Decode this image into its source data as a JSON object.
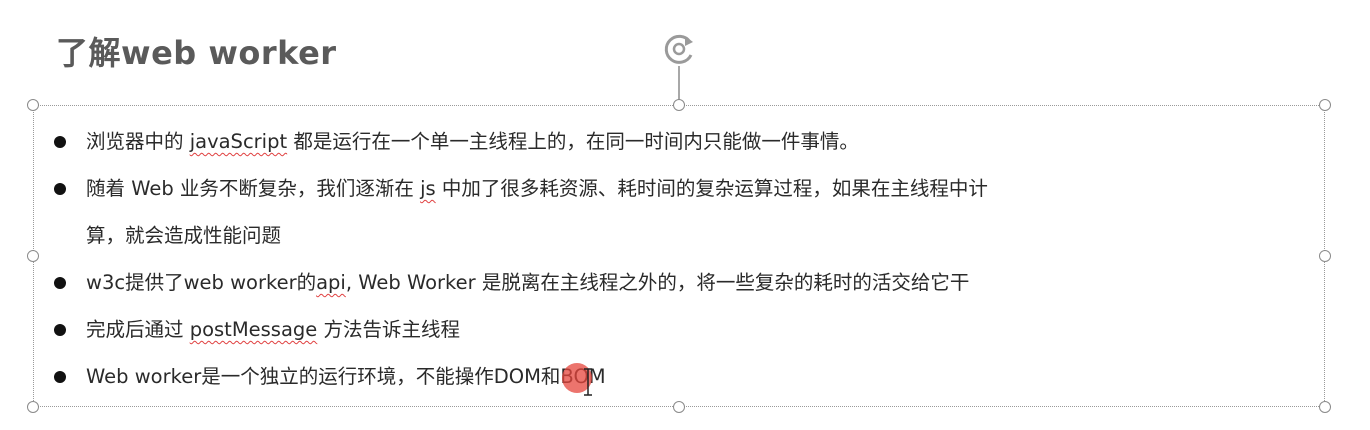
{
  "slide": {
    "title": "了解web worker"
  },
  "bullets": [
    {
      "parts": [
        {
          "text": "浏览器中的 "
        },
        {
          "text": "javaScript",
          "spellcheck": true
        },
        {
          "text": " 都是运行在一个单一主线程上的，在同一时间内只能做一件事情。"
        }
      ]
    },
    {
      "parts": [
        {
          "text": "随着 Web 业务不断复杂，我们逐渐在 "
        },
        {
          "text": "js",
          "spellcheck": true
        },
        {
          "text": " 中加了很多耗资源、耗时间的复杂运算过程，如果在主线程中计"
        }
      ],
      "continuation": "算，就会造成性能问题"
    },
    {
      "parts": [
        {
          "text": "w3c提供了web worker的"
        },
        {
          "text": "api",
          "spellcheck": true
        },
        {
          "text": ", Web Worker 是脱离在主线程之外的，将一些复杂的耗时的活交给它干"
        }
      ]
    },
    {
      "parts": [
        {
          "text": "完成后通过 "
        },
        {
          "text": "postMessage",
          "spellcheck": true
        },
        {
          "text": " 方法告诉主线程"
        }
      ]
    },
    {
      "parts": [
        {
          "text": "Web worker是一个独立的运行环境，不能操作DOM和BOM"
        }
      ]
    }
  ],
  "colors": {
    "title": "#5a5a5a",
    "body_text": "#2a2a2a",
    "selection_border": "#9a9a9a",
    "spellcheck_underline": "#e04040",
    "pointer_highlight": "#e6463c"
  },
  "icons": {
    "rotate_handle": "rotate-icon",
    "bullet": "bullet-dot-icon",
    "text_cursor": "ibeam-cursor-icon"
  }
}
